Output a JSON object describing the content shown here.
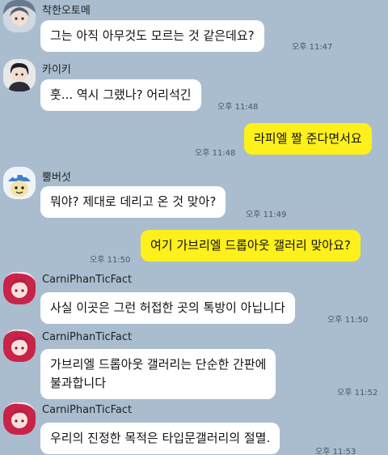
{
  "messages": [
    {
      "type": "in",
      "sender": "착한오토메",
      "avatar": "avatar-icon-anime-girl",
      "lines": [
        "그는 아직 아무것도 모르는 것 같은데요?"
      ],
      "time": "오후 11:47"
    },
    {
      "type": "in",
      "sender": "카이키",
      "avatar": "avatar-icon-dark-haired-man",
      "lines": [
        "훗... 역시 그랬나? 어리석긴"
      ],
      "time": "오후 11:48"
    },
    {
      "type": "out",
      "lines": [
        "라피엘 짤 준다면서요"
      ],
      "time": "오후 11:48"
    },
    {
      "type": "in",
      "sender": "뿔버섯",
      "avatar": "avatar-icon-mushroom-character",
      "lines": [
        "뭐야? 제대로 데리고 온 것 맞아?"
      ],
      "time": "오후 11:49"
    },
    {
      "type": "out",
      "lines": [
        "여기 가브리엘 드롭아웃 갤러리 맞아요?"
      ],
      "time": "오후 11:50"
    },
    {
      "type": "in",
      "sender": "CarniPhanTicFact",
      "avatar": "avatar-icon-red-hair-girl",
      "lines": [
        "사실 이곳은 그런 허접한 곳의 톡방이 아닙니다"
      ],
      "time": "오후 11:50"
    },
    {
      "type": "in",
      "sender": "CarniPhanTicFact",
      "avatar": "avatar-icon-red-hair-girl",
      "lines": [
        "가브리엘 드롭아웃 갤러리는 단순한 간판에",
        "불과합니다"
      ],
      "time": "오후 11:52"
    },
    {
      "type": "in",
      "sender": "CarniPhanTicFact",
      "avatar": "avatar-icon-red-hair-girl",
      "lines": [
        "우리의 진정한 목적은 타입문갤러리의 절멸."
      ],
      "time": "오후 11:53"
    }
  ],
  "colors": {
    "background": "#a9bdcf",
    "incoming_bubble": "#ffffff",
    "outgoing_bubble": "#fef01b"
  }
}
